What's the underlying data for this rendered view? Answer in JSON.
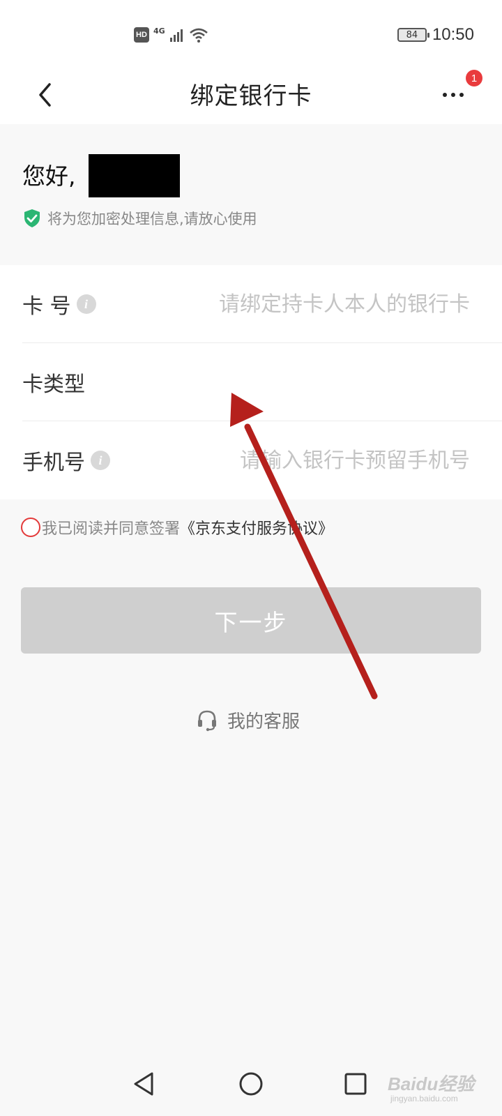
{
  "status_bar": {
    "hd": "HD",
    "network": "4G",
    "battery": "84",
    "time": "10:50",
    "icons": [
      "hd-icon",
      "signal-icon",
      "wifi-icon",
      "battery-icon"
    ]
  },
  "header": {
    "title": "绑定银行卡",
    "back_icon": "chevron-left-icon",
    "more_icon": "more-dots-icon",
    "notification_count": "1"
  },
  "greeting": {
    "text": "您好,",
    "security_note": "将为您加密处理信息,请放心使用",
    "security_icon": "shield-check-icon"
  },
  "form": {
    "card_number": {
      "label": "卡 号",
      "placeholder": "请绑定持卡人本人的银行卡",
      "value": ""
    },
    "card_type": {
      "label": "卡类型",
      "value": ""
    },
    "phone": {
      "label": "手机号",
      "placeholder": "请输入银行卡预留手机号",
      "value": ""
    },
    "info_icon_text": "i"
  },
  "agreement": {
    "text": "我已阅读并同意签署",
    "link": "《京东支付服务协议》",
    "checked": false
  },
  "next_button": "下一步",
  "service": {
    "label": "我的客服",
    "icon": "headset-icon"
  },
  "nav_bar": {
    "icons": [
      "back-triangle-icon",
      "home-circle-icon",
      "recent-square-icon"
    ]
  },
  "watermark": {
    "text": "Baidu经验",
    "url": "jingyan.baidu.com"
  },
  "colors": {
    "accent_red": "#e33a3a",
    "shield_green": "#2bb673",
    "button_disabled": "#cfcfcf",
    "annotation_arrow": "#b5201c"
  }
}
